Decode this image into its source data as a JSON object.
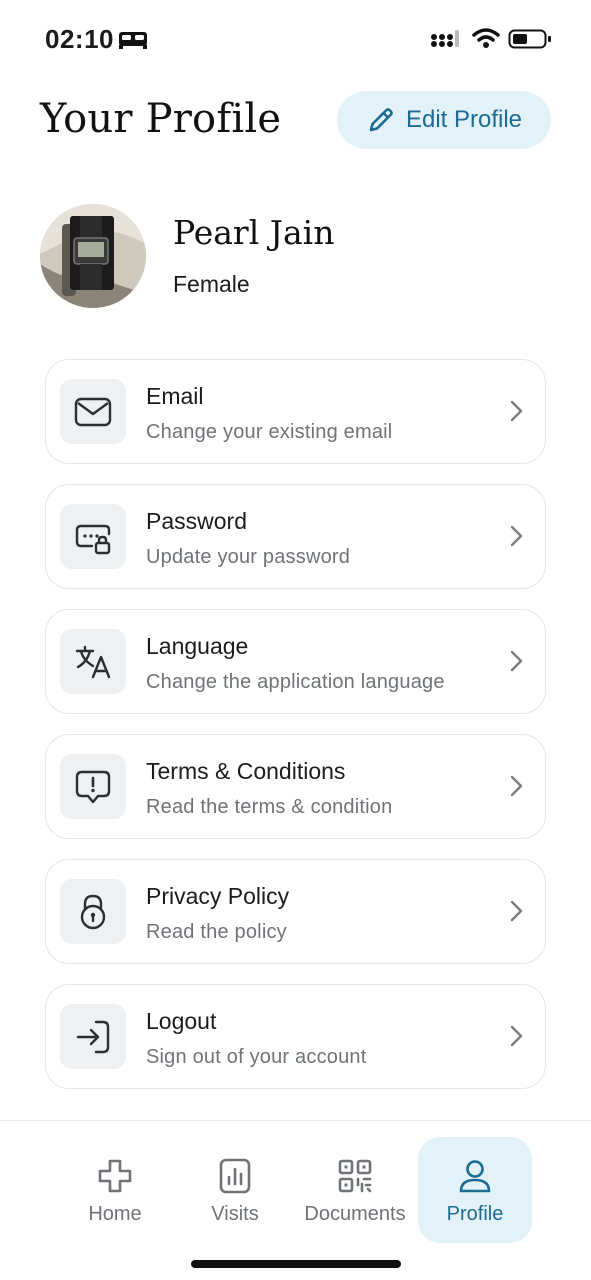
{
  "status_bar": {
    "time": "02:10",
    "icons": [
      "sleep-bed-icon",
      "cellular-signal-icon",
      "wifi-icon",
      "battery-icon"
    ]
  },
  "header": {
    "title": "Your Profile",
    "edit_button": {
      "label": "Edit Profile",
      "icon": "pencil-icon"
    }
  },
  "profile": {
    "name": "Pearl Jain",
    "gender": "Female",
    "avatar": "wristwatch-photo"
  },
  "menu": [
    {
      "title": "Email",
      "subtitle": "Change your existing email",
      "icon": "envelope-icon"
    },
    {
      "title": "Password",
      "subtitle": "Update your password",
      "icon": "password-lock-icon"
    },
    {
      "title": "Language",
      "subtitle": "Change the application language",
      "icon": "translate-icon"
    },
    {
      "title": "Terms & Conditions",
      "subtitle": "Read the terms & condition",
      "icon": "alert-message-icon"
    },
    {
      "title": "Privacy Policy",
      "subtitle": "Read the policy",
      "icon": "padlock-icon"
    },
    {
      "title": "Logout",
      "subtitle": "Sign out of your account",
      "icon": "logout-icon"
    }
  ],
  "tab_bar": {
    "tabs": [
      {
        "label": "Home",
        "icon": "plus-cross-icon",
        "active": false
      },
      {
        "label": "Visits",
        "icon": "report-chart-icon",
        "active": false
      },
      {
        "label": "Documents",
        "icon": "qr-code-icon",
        "active": false
      },
      {
        "label": "Profile",
        "icon": "user-icon",
        "active": true
      }
    ]
  },
  "colors": {
    "accent": "#1d6b92",
    "accent_bg": "#e3f2f8",
    "icon_tile_bg": "#eef0f1",
    "card_border": "#e4e6e8",
    "muted_text": "#6f7378"
  }
}
